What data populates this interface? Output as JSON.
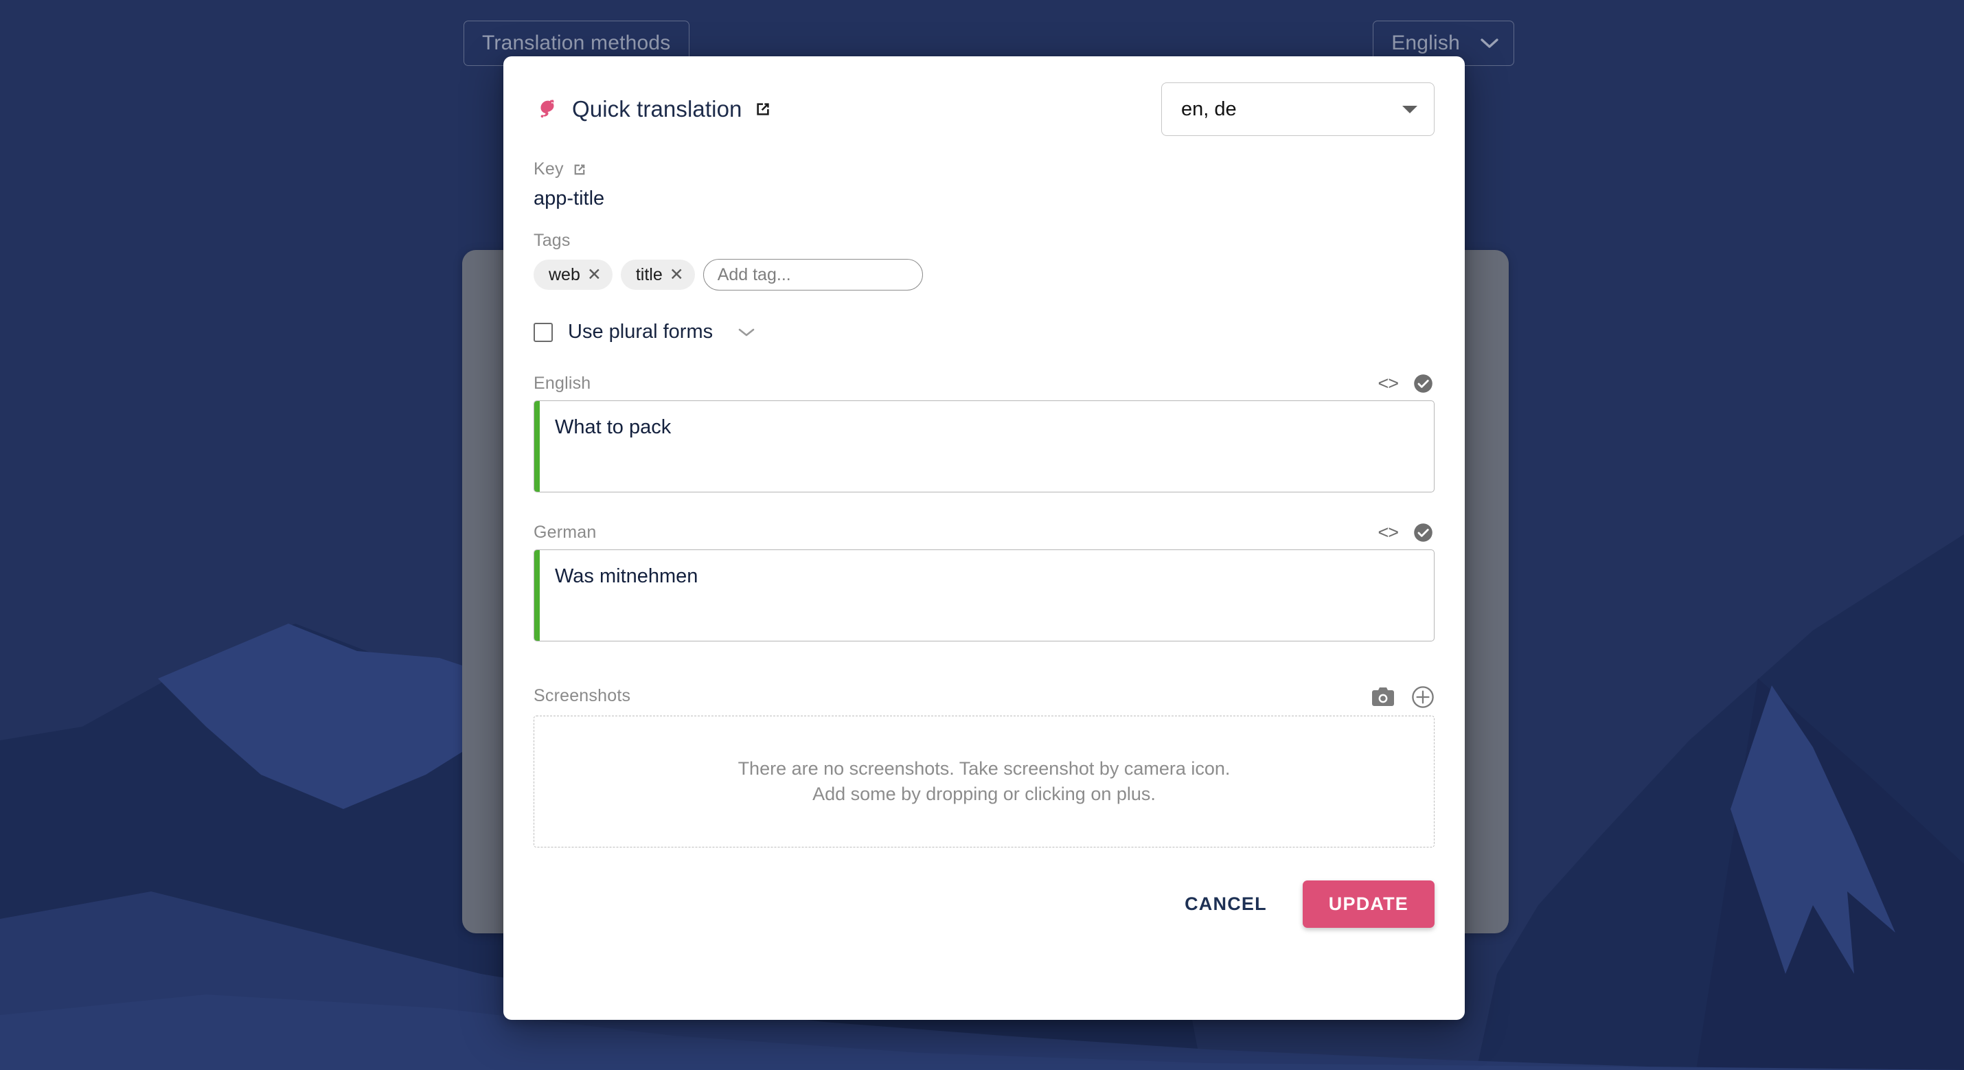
{
  "background": {
    "page_background_color": "#23325e",
    "translation_methods_button": "Translation methods",
    "language_selector": "English",
    "language_selector_icon": "chevron-down-icon"
  },
  "dialog": {
    "logo_icon": "tolgee-mouse-logo-icon",
    "title": "Quick translation",
    "title_external_link_icon": "external-link-icon",
    "language_scope": {
      "value": "en, de",
      "dropdown_icon": "triangle-down-icon"
    },
    "key": {
      "label": "Key",
      "external_link_icon": "external-link-icon",
      "value": "app-title"
    },
    "tags": {
      "label": "Tags",
      "items": [
        {
          "label": "web",
          "remove_icon": "close-icon"
        },
        {
          "label": "title",
          "remove_icon": "close-icon"
        }
      ],
      "input_placeholder": "Add tag...",
      "input_value": ""
    },
    "plural": {
      "checkbox_checked": false,
      "label": "Use plural forms",
      "expand_icon": "chevron-down-icon"
    },
    "translations": [
      {
        "language": "English",
        "value": "What to pack",
        "code_icon": "code-brackets-icon",
        "state_icon": "check-circle-icon",
        "state_bar_color": "#4caf30"
      },
      {
        "language": "German",
        "value": "Was mitnehmen",
        "code_icon": "code-brackets-icon",
        "state_icon": "check-circle-icon",
        "state_bar_color": "#4caf30"
      }
    ],
    "screenshots": {
      "label": "Screenshots",
      "camera_icon": "camera-icon",
      "add_icon": "plus-circle-icon",
      "empty_line_1": "There are no screenshots. Take screenshot by camera icon.",
      "empty_line_2": "Add some by dropping or clicking on plus."
    },
    "footer": {
      "cancel_label": "CANCEL",
      "update_label": "UPDATE",
      "update_color": "#dd4f77"
    }
  }
}
